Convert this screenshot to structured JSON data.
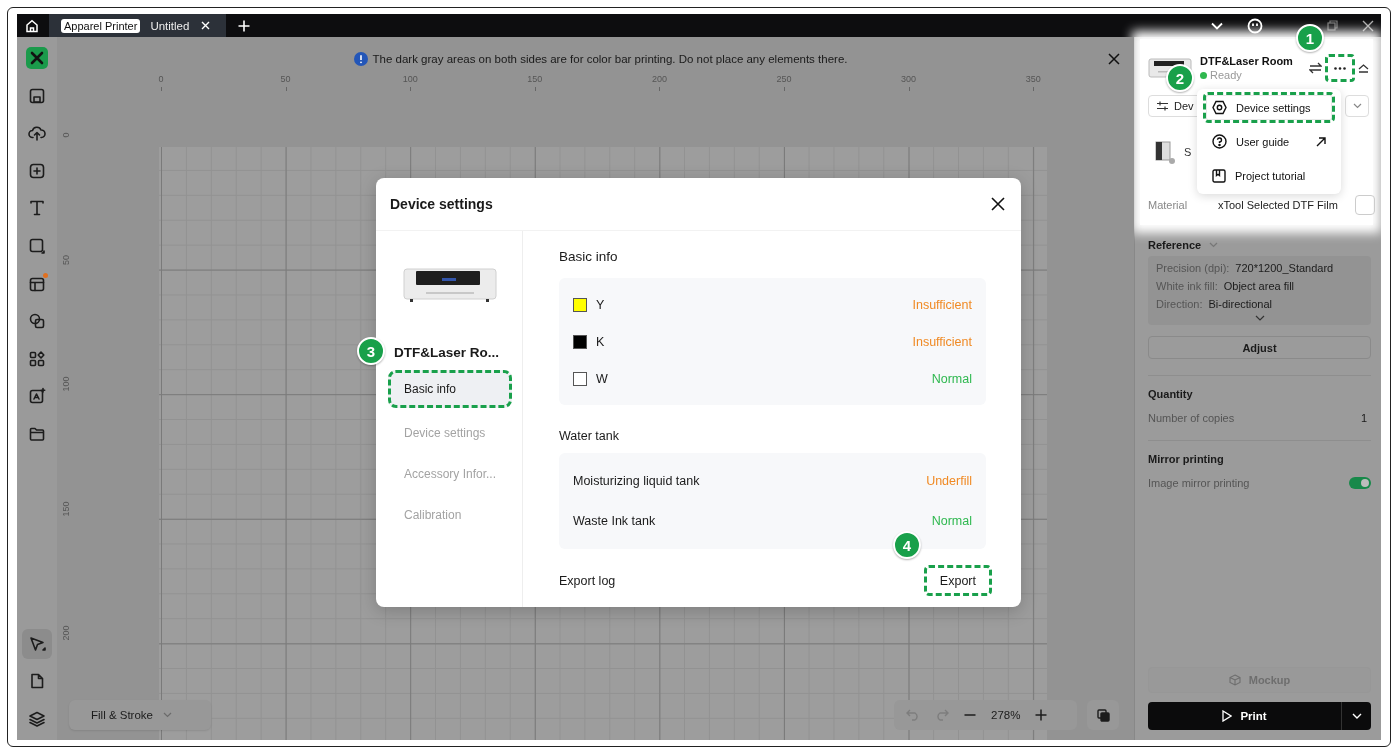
{
  "title_bar": {
    "mode_badge": "Apparel Printer",
    "tabs": [
      {
        "label": "Untitled",
        "selected": true
      }
    ]
  },
  "toolbar": {
    "tools": [
      {
        "kind": "logo",
        "selected": false,
        "notify": false
      },
      {
        "kind": "save",
        "selected": false,
        "notify": false
      },
      {
        "kind": "upload",
        "selected": false,
        "notify": false
      },
      {
        "kind": "add",
        "selected": false,
        "notify": false
      },
      {
        "kind": "text",
        "selected": false,
        "notify": false
      },
      {
        "kind": "shape",
        "selected": false,
        "notify": false
      },
      {
        "kind": "layout",
        "selected": false,
        "notify": true
      },
      {
        "kind": "combine",
        "selected": false,
        "notify": false
      },
      {
        "kind": "apps",
        "selected": false,
        "notify": false
      },
      {
        "kind": "ai",
        "selected": false,
        "notify": false
      },
      {
        "kind": "folder",
        "selected": false,
        "notify": false
      }
    ],
    "bottom_tools": [
      {
        "kind": "select",
        "selected": true,
        "notify": false
      },
      {
        "kind": "page",
        "selected": false,
        "notify": false
      },
      {
        "kind": "layers",
        "selected": false,
        "notify": false
      }
    ]
  },
  "notice": {
    "text": "The dark gray areas on both sides are for color bar printing. Do not place any elements there."
  },
  "rulers": {
    "x_labels": [
      "0",
      "50",
      "100",
      "150",
      "200",
      "250",
      "300",
      "350"
    ],
    "y_labels": [
      "0",
      "50",
      "100",
      "150",
      "200"
    ]
  },
  "canvas_footer": {
    "fill_stroke": "Fill & Stroke",
    "zoom": "278%"
  },
  "panel": {
    "device": {
      "name": "DTF&Laser Room",
      "status": "Ready",
      "online": true
    },
    "more_button": {
      "step": "1",
      "highlighted": true
    },
    "device_button": "Dev",
    "slot_label": "S",
    "material": {
      "label": "Material",
      "value": "xTool Selected DTF Film"
    },
    "reference": {
      "heading": "Reference",
      "rows": [
        {
          "label": "Precision (dpi):",
          "value": "720*1200_Standard"
        },
        {
          "label": "White ink fill:",
          "value": "Object area fill"
        },
        {
          "label": "Direction:",
          "value": "Bi-directional"
        }
      ]
    },
    "adjust": "Adjust",
    "quantity": {
      "heading": "Quantity",
      "label": "Number of copies",
      "value": "1"
    },
    "mirror": {
      "heading": "Mirror printing",
      "label": "Image mirror printing",
      "on": true
    },
    "mockup": {
      "label": "Mockup",
      "disabled": true
    },
    "print": "Print"
  },
  "menu": {
    "items": [
      {
        "label": "Device settings",
        "kind": "settings",
        "external": false,
        "highlighted": true,
        "step": "2"
      },
      {
        "label": "User guide",
        "kind": "help",
        "external": true,
        "highlighted": false
      },
      {
        "label": "Project tutorial",
        "kind": "tutorial",
        "external": false,
        "highlighted": false
      }
    ]
  },
  "modal": {
    "title": "Device settings",
    "device_name": "DTF&Laser Ro...",
    "nav": [
      {
        "label": "Basic info",
        "selected": true,
        "highlighted": true,
        "step": "3"
      },
      {
        "label": "Device settings",
        "selected": false,
        "highlighted": false
      },
      {
        "label": "Accessory Infor...",
        "selected": false,
        "highlighted": false
      },
      {
        "label": "Calibration",
        "selected": false,
        "highlighted": false
      }
    ],
    "basic_info": {
      "heading": "Basic info",
      "inks": [
        {
          "label": "Y",
          "color": "#ffff00",
          "status": {
            "text": "Insufficient",
            "color": "#f08a24"
          }
        },
        {
          "label": "K",
          "color": "#000000",
          "status": {
            "text": "Insufficient",
            "color": "#f08a24"
          }
        },
        {
          "label": "W",
          "color": "#ffffff",
          "status": {
            "text": "Normal",
            "color": "#2fb84f"
          }
        }
      ]
    },
    "water_tank": {
      "heading": "Water tank",
      "items": [
        {
          "label": "Moisturizing liquid tank",
          "status": {
            "text": "Underfill",
            "color": "#f08a24"
          }
        },
        {
          "label": "Waste Ink tank",
          "status": {
            "text": "Normal",
            "color": "#2fb84f"
          }
        }
      ]
    },
    "export": {
      "label": "Export log",
      "button": "Export",
      "highlighted": true,
      "step": "4"
    }
  }
}
